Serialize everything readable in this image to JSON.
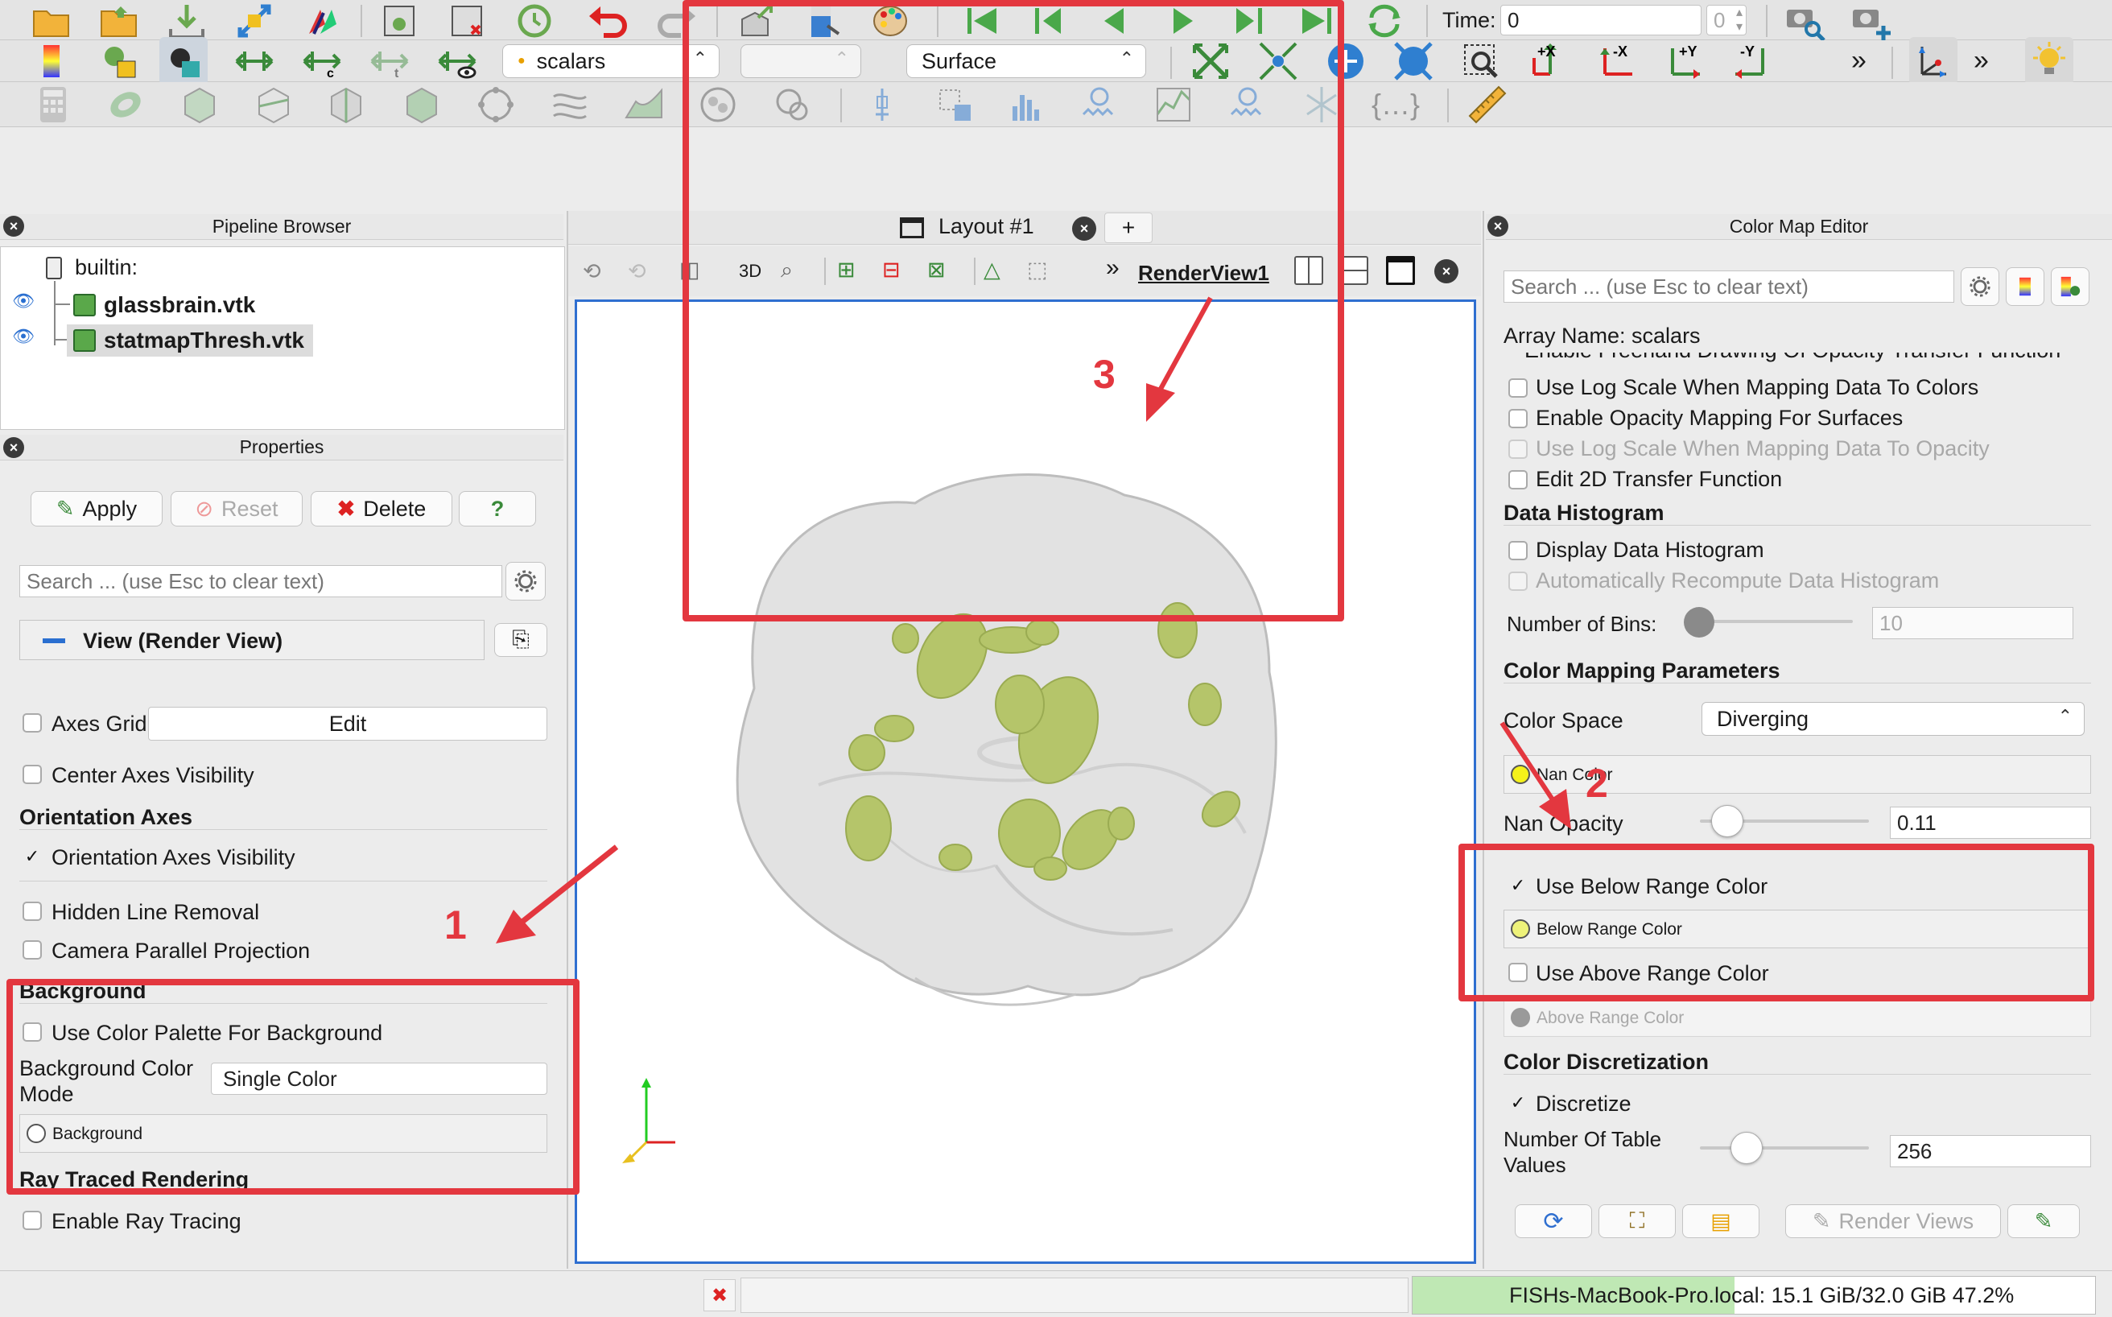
{
  "toolbar1": {
    "time_label": "Time:",
    "time_value": "0",
    "time_spin_value": "0"
  },
  "toolbar2": {
    "array_combo": "scalars",
    "component_combo": "",
    "representation_combo": "Surface",
    "camera_buttons": [
      "+X",
      "-X",
      "+Y",
      "-Y"
    ]
  },
  "pipeline": {
    "title": "Pipeline Browser",
    "root": "builtin:",
    "items": [
      "glassbrain.vtk",
      "statmapThresh.vtk"
    ]
  },
  "properties": {
    "title": "Properties",
    "apply": "Apply",
    "reset": "Reset",
    "delete": "Delete",
    "help": "?",
    "search_placeholder": "Search ... (use Esc to clear text)",
    "view_section": "View (Render View)",
    "axes_grid": "Axes Grid",
    "edit": "Edit",
    "center_axes": "Center Axes Visibility",
    "orientation_header": "Orientation Axes",
    "orientation_visibility": "Orientation Axes Visibility",
    "hidden_line": "Hidden Line Removal",
    "camera_parallel": "Camera Parallel Projection",
    "background_header": "Background",
    "use_palette": "Use Color Palette For Background",
    "bg_color_mode_label_1": "Background Color",
    "bg_color_mode_label_2": "Mode",
    "bg_color_mode_value": "Single Color",
    "background_swatch": "Background",
    "ray_header": "Ray Traced Rendering",
    "enable_ray": "Enable Ray Tracing"
  },
  "layout": {
    "tab": "Layout #1",
    "add_tab": "+",
    "view_btn_3d": "3D",
    "render_view_name": "RenderView1"
  },
  "cme": {
    "title": "Color Map Editor",
    "search_placeholder": "Search ... (use Esc to clear text)",
    "array_name": "Array Name: scalars",
    "partial_top": "Enable Freehand Drawing Of Opacity Transfer Function",
    "log_scale_colors": "Use Log Scale When Mapping Data To Colors",
    "opacity_mapping": "Enable Opacity Mapping For Surfaces",
    "log_scale_opacity": "Use Log Scale When Mapping Data To Opacity",
    "edit_2d": "Edit 2D Transfer Function",
    "data_histogram_header": "Data Histogram",
    "display_histogram": "Display Data Histogram",
    "auto_recompute": "Automatically Recompute Data Histogram",
    "num_bins_label": "Number of Bins:",
    "num_bins_value": "10",
    "cmp_header": "Color Mapping Parameters",
    "color_space_label": "Color Space",
    "color_space_value": "Diverging",
    "nan_color": "Nan Color",
    "nan_opacity_label": "Nan Opacity",
    "nan_opacity_value": "0.11",
    "use_below": "Use Below Range Color",
    "below_color": "Below Range Color",
    "use_above": "Use Above Range Color",
    "above_color": "Above Range Color",
    "discretization_header": "Color Discretization",
    "discretize": "Discretize",
    "num_table_label_1": "Number Of Table",
    "num_table_label_2": "Values",
    "num_table_value": "256",
    "render_views": "Render Views"
  },
  "annotations": {
    "label1": "1",
    "label2": "2",
    "label3": "3"
  },
  "status": {
    "memory": "FISHs-MacBook-Pro.local: 15.1 GiB/32.0 GiB 47.2%",
    "memory_fraction": 0.472
  },
  "colors": {
    "annotation_red": "#e3373f",
    "blob_green": "#b5c56a",
    "view_border_blue": "#2f6fd0",
    "memory_bar": "#bfe8b4"
  }
}
